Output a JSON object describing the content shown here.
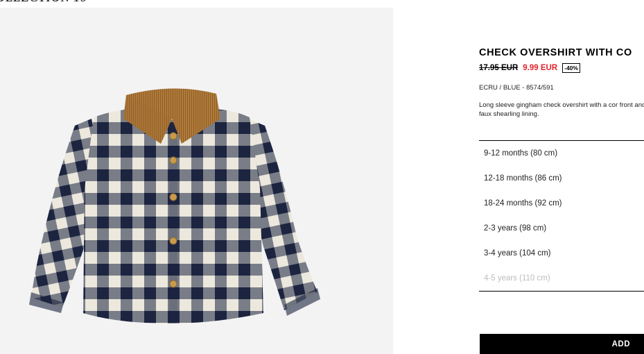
{
  "collection_heading": "OLLECTION 19",
  "product": {
    "title": "CHECK OVERSHIRT WITH CO",
    "old_price": "17.95 EUR",
    "new_price": "9.99 EUR",
    "discount": "-40%",
    "color_ref": "ECRU / BLUE - 8574/591",
    "description": "Long sleeve gingham check overshirt with a cor front and faux shearling lining.",
    "image_icon": "checked-shirt-image"
  },
  "sizes": [
    {
      "label": "9-12 months (80 cm)",
      "available": true
    },
    {
      "label": "12-18 months (86 cm)",
      "available": true
    },
    {
      "label": "18-24 months (92 cm)",
      "available": true
    },
    {
      "label": "2-3 years (98 cm)",
      "available": true
    },
    {
      "label": "3-4 years (104 cm)",
      "available": true
    },
    {
      "label": "4-5 years (110 cm)",
      "available": false
    }
  ],
  "add_button_label": "ADD",
  "colors": {
    "sale_price": "#e0232b",
    "check_navy": "#1c2440",
    "check_ecru": "#ece8dd",
    "collar_corduroy": "#b07a3a",
    "unavailable_size": "#bdbdbd"
  }
}
